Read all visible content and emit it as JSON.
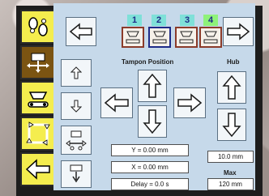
{
  "tabs": [
    {
      "num": "1",
      "color": "#7fe0d8"
    },
    {
      "num": "2",
      "color": "#7fe0d8"
    },
    {
      "num": "3",
      "color": "#7fe0d8"
    },
    {
      "num": "4",
      "color": "#8ef27a"
    }
  ],
  "labels": {
    "tampon_position": "Tampon Position",
    "hub": "Hub",
    "max": "Max"
  },
  "fields": {
    "y": "Y = 0.00 mm",
    "x": "X = 0.00 mm",
    "delay": "Delay = 0.0 s",
    "hub_value": "10.0 mm",
    "max_value": "120 mm"
  },
  "icons": {
    "side": [
      "footprints-icon",
      "move-cross-icon",
      "tampon-station-icon",
      "cycle-icon",
      "back-arrow-icon"
    ],
    "nav": [
      "arrow-left-icon",
      "arrow-right-icon"
    ]
  }
}
